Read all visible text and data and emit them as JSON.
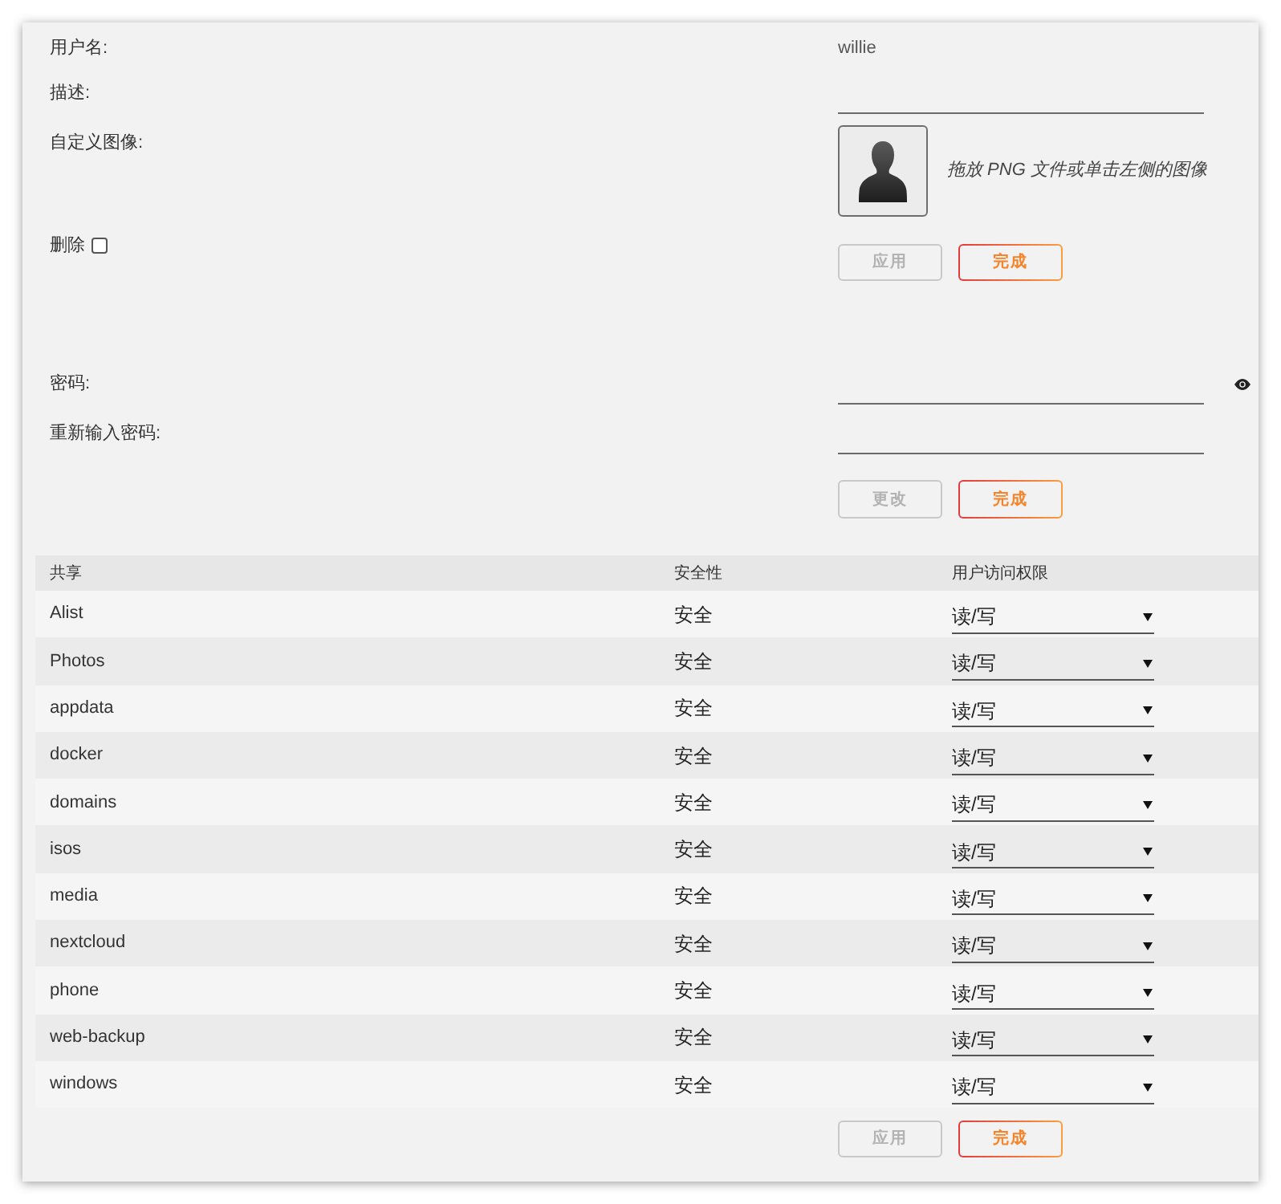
{
  "profile": {
    "username": {
      "label": "用户名:",
      "value": "willie"
    },
    "description": {
      "label": "描述:"
    },
    "custom_image": {
      "label": "自定义图像:",
      "hint": "拖放 PNG 文件或单击左侧的图像"
    },
    "delete": {
      "label": "删除",
      "checked": false
    },
    "buttons": [
      {
        "label": "应用",
        "disabled": true
      },
      {
        "label": "完成",
        "disabled": false
      }
    ]
  },
  "password": {
    "reveal_toggle": true,
    "fields": [
      {
        "label": "密码:"
      },
      {
        "label": "重新输入密码:"
      }
    ],
    "buttons": [
      {
        "label": "更改",
        "disabled": true
      },
      {
        "label": "完成",
        "disabled": false
      }
    ]
  },
  "shares_table": {
    "columns": [
      "共享",
      "安全性",
      "用户访问权限"
    ],
    "rows": [
      {
        "share": "Alist",
        "security": "安全",
        "access": "读/写"
      },
      {
        "share": "Photos",
        "security": "安全",
        "access": "读/写"
      },
      {
        "share": "appdata",
        "security": "安全",
        "access": "读/写"
      },
      {
        "share": "docker",
        "security": "安全",
        "access": "读/写"
      },
      {
        "share": "domains",
        "security": "安全",
        "access": "读/写"
      },
      {
        "share": "isos",
        "security": "安全",
        "access": "读/写"
      },
      {
        "share": "media",
        "security": "安全",
        "access": "读/写"
      },
      {
        "share": "nextcloud",
        "security": "安全",
        "access": "读/写"
      },
      {
        "share": "phone",
        "security": "安全",
        "access": "读/写"
      },
      {
        "share": "web-backup",
        "security": "安全",
        "access": "读/写"
      },
      {
        "share": "windows",
        "security": "安全",
        "access": "读/写"
      }
    ]
  },
  "table_buttons": [
    {
      "label": "应用",
      "disabled": true
    },
    {
      "label": "完成",
      "disabled": false
    }
  ]
}
